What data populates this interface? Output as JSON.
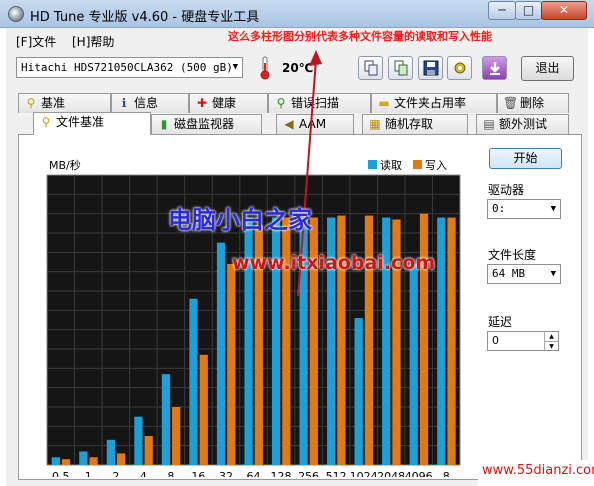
{
  "window": {
    "title": "HD Tune 专业版 v4.60 - 硬盘专业工具",
    "min_label": "─",
    "max_label": "□",
    "close_label": "✕"
  },
  "menu": {
    "file": "[F]文件",
    "help": "[H]帮助"
  },
  "annotation": "这么多柱形图分别代表多种文件容量的读取和写入性能",
  "toolbar": {
    "drive": "Hitachi HDS721050CLA362 (500 gB)",
    "temperature": "20℃",
    "exit_label": "退出",
    "icons": [
      "copy-info-icon",
      "copy-screenshot-icon",
      "save-icon",
      "options-icon",
      "download-icon"
    ]
  },
  "tabs_top": [
    {
      "label": "基准",
      "icon": "benchmark-icon"
    },
    {
      "label": "信息",
      "icon": "info-icon"
    },
    {
      "label": "健康",
      "icon": "health-icon"
    },
    {
      "label": "错误扫描",
      "icon": "error-scan-icon"
    },
    {
      "label": "文件夹占用率",
      "icon": "folder-usage-icon"
    },
    {
      "label": "删除",
      "icon": "erase-icon"
    }
  ],
  "tabs_bottom": [
    {
      "label": "文件基准",
      "icon": "file-benchmark-icon",
      "active": true
    },
    {
      "label": "磁盘监视器",
      "icon": "disk-monitor-icon"
    },
    {
      "label": "AAM",
      "icon": "speaker-icon"
    },
    {
      "label": "随机存取",
      "icon": "random-access-icon"
    },
    {
      "label": "额外测试",
      "icon": "extra-tests-icon"
    }
  ],
  "controls": {
    "start_label": "开始",
    "drive_label": "驱动器",
    "drive_value": "0:",
    "file_length_label": "文件长度",
    "file_length_value": "64 MB",
    "delay_label": "延迟",
    "delay_value": "0"
  },
  "colors": {
    "read": "#1ca0d8",
    "write": "#e07a14",
    "plot_bg": "#151515",
    "grid": "#3a3a3a"
  },
  "watermarks": {
    "name": "电脑小白之家",
    "url": "www.itxiaobai.com",
    "corner": "www.55dianzi.com"
  },
  "chart_data": {
    "type": "bar",
    "ylabel": "MB/秒",
    "ylim": [
      0,
      150
    ],
    "yticks": [
      50,
      100,
      150
    ],
    "categories": [
      "0.5",
      "1",
      "2",
      "4",
      "8",
      "16",
      "32",
      "64",
      "128",
      "256",
      "512",
      "1024",
      "2048",
      "4096",
      "8"
    ],
    "series": [
      {
        "name": "读取",
        "values": [
          4,
          7,
          13,
          25,
          47,
          86,
          115,
          128,
          128,
          128,
          128,
          76,
          128,
          104,
          128
        ]
      },
      {
        "name": "写入",
        "values": [
          3,
          4,
          6,
          15,
          30,
          57,
          104,
          124,
          128,
          128,
          129,
          129,
          127,
          130,
          128
        ]
      }
    ],
    "legend": "top-right",
    "grid": true
  }
}
